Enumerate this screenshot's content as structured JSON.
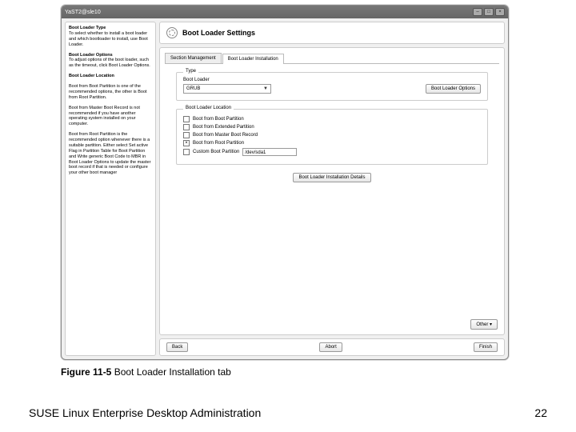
{
  "window": {
    "title": "YaST2@sle10"
  },
  "titlebar_buttons": {
    "min": "–",
    "max": "□",
    "close": "×"
  },
  "sidebar": {
    "s1_title": "Boot Loader Type",
    "s1_body": "To select whether to install a boot loader and which bootloader to install, use Boot Loader.",
    "s2_title": "Boot Loader Options",
    "s2_body": "To adjust options of the boot loader, such as the timeout, click Boot Loader Options.",
    "s3_title": "Boot Loader Location",
    "s3_body1": "Boot from Boot Partition is one of the recommended options, the other is Boot from Root Partition.",
    "s3_body2": "Boot from Master Boot Record is not recommended if you have another operating system installed on your computer.",
    "s3_body3": "Boot from Root Partition is the recommended option whenever there is a suitable partition. Either select Set active Flag in Partition Table for Boot Partition and Write generic Boot Code to MBR in Boot Loader Options to update the master boot record if that is needed or configure your other boot manager"
  },
  "header": {
    "title": "Boot Loader Settings"
  },
  "tabs": {
    "t0": "Section Management",
    "t1": "Boot Loader Installation"
  },
  "type_group": {
    "legend": "Type",
    "label": "Boot Loader",
    "value": "GRUB",
    "options_btn": "Boot Loader Options"
  },
  "loc_group": {
    "legend": "Boot Loader Location",
    "c1": "Boot from Boot Partition",
    "c2": "Boot from Extended Partition",
    "c3": "Boot from Master Boot Record",
    "c4": "Boot from Root Partition",
    "c5": "Custom Boot Partition",
    "c5_value": "/dev/sda1"
  },
  "details_btn": "Boot Loader Installation Details",
  "other_btn": "Other ▾",
  "footer": {
    "back": "Back",
    "abort": "Abort",
    "finish": "Finish"
  },
  "caption": {
    "fig": "Figure 11-5 ",
    "txt": "Boot Loader Installation tab"
  },
  "page_footer": {
    "left": "SUSE Linux Enterprise Desktop Administration",
    "right": "22"
  }
}
